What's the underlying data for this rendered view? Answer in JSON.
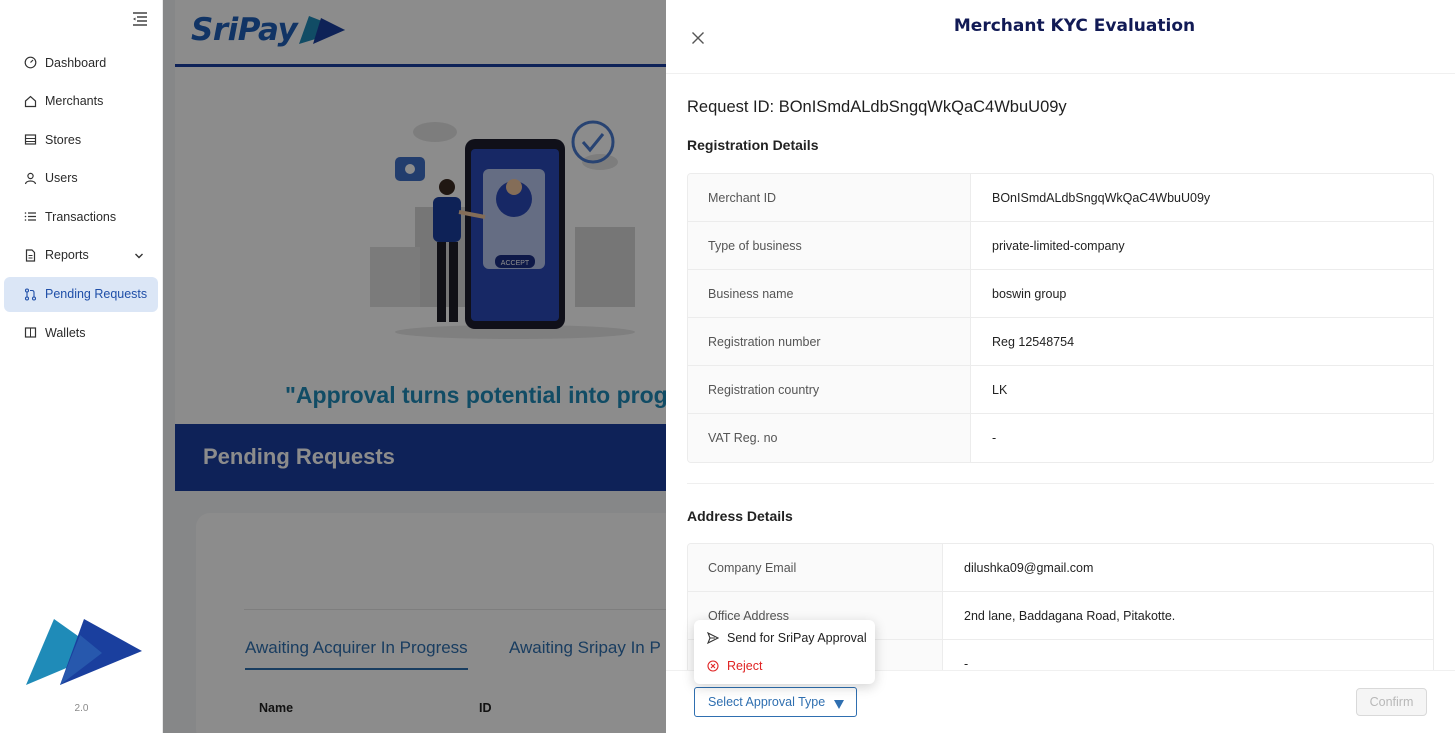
{
  "sidebar": {
    "items": [
      {
        "label": "Dashboard"
      },
      {
        "label": "Merchants"
      },
      {
        "label": "Stores"
      },
      {
        "label": "Users"
      },
      {
        "label": "Transactions"
      },
      {
        "label": "Reports"
      },
      {
        "label": "Pending Requests",
        "active": true
      },
      {
        "label": "Wallets"
      }
    ],
    "version": "2.0"
  },
  "header": {
    "brand": "SriPay"
  },
  "hero": {
    "quote": "\"Approval turns potential into progre",
    "illustration_button": "ACCEPT"
  },
  "page": {
    "title": "Pending Requests",
    "tabs": [
      {
        "label": "Awaiting Acquirer In Progress",
        "active": true
      },
      {
        "label": "Awaiting Sripay In P"
      }
    ],
    "table_headers": [
      "Name",
      "ID"
    ]
  },
  "drawer": {
    "title": "Merchant KYC Evaluation",
    "request_id": "Request ID: BOnISmdALdbSngqWkQaC4WbuU09y",
    "registration": {
      "title": "Registration Details",
      "rows": [
        {
          "label": "Merchant ID",
          "value": "BOnISmdALdbSngqWkQaC4WbuU09y"
        },
        {
          "label": "Type of business",
          "value": "private-limited-company"
        },
        {
          "label": "Business name",
          "value": "boswin group"
        },
        {
          "label": "Registration number",
          "value": "Reg 12548754"
        },
        {
          "label": "Registration country",
          "value": "LK"
        },
        {
          "label": "VAT Reg. no",
          "value": "-"
        }
      ]
    },
    "address": {
      "title": "Address Details",
      "rows": [
        {
          "label": "Company Email",
          "value": "dilushka09@gmail.com"
        },
        {
          "label": "Office Address",
          "value": "2nd lane, Baddagana Road, Pitakotte."
        },
        {
          "label": "",
          "value": "-"
        }
      ]
    },
    "footer": {
      "select_placeholder": "Select Approval Type",
      "confirm_label": "Confirm"
    },
    "dropdown": {
      "options": [
        {
          "label": "Send for SriPay Approval",
          "icon": "send-icon"
        },
        {
          "label": "Reject",
          "icon": "close-circle-icon",
          "color": "#e02424"
        }
      ]
    }
  },
  "colors": {
    "primary": "#1a3fa0",
    "accent": "#2f6fb0",
    "danger": "#e02424",
    "active_nav_bg": "#dbe6f6"
  }
}
